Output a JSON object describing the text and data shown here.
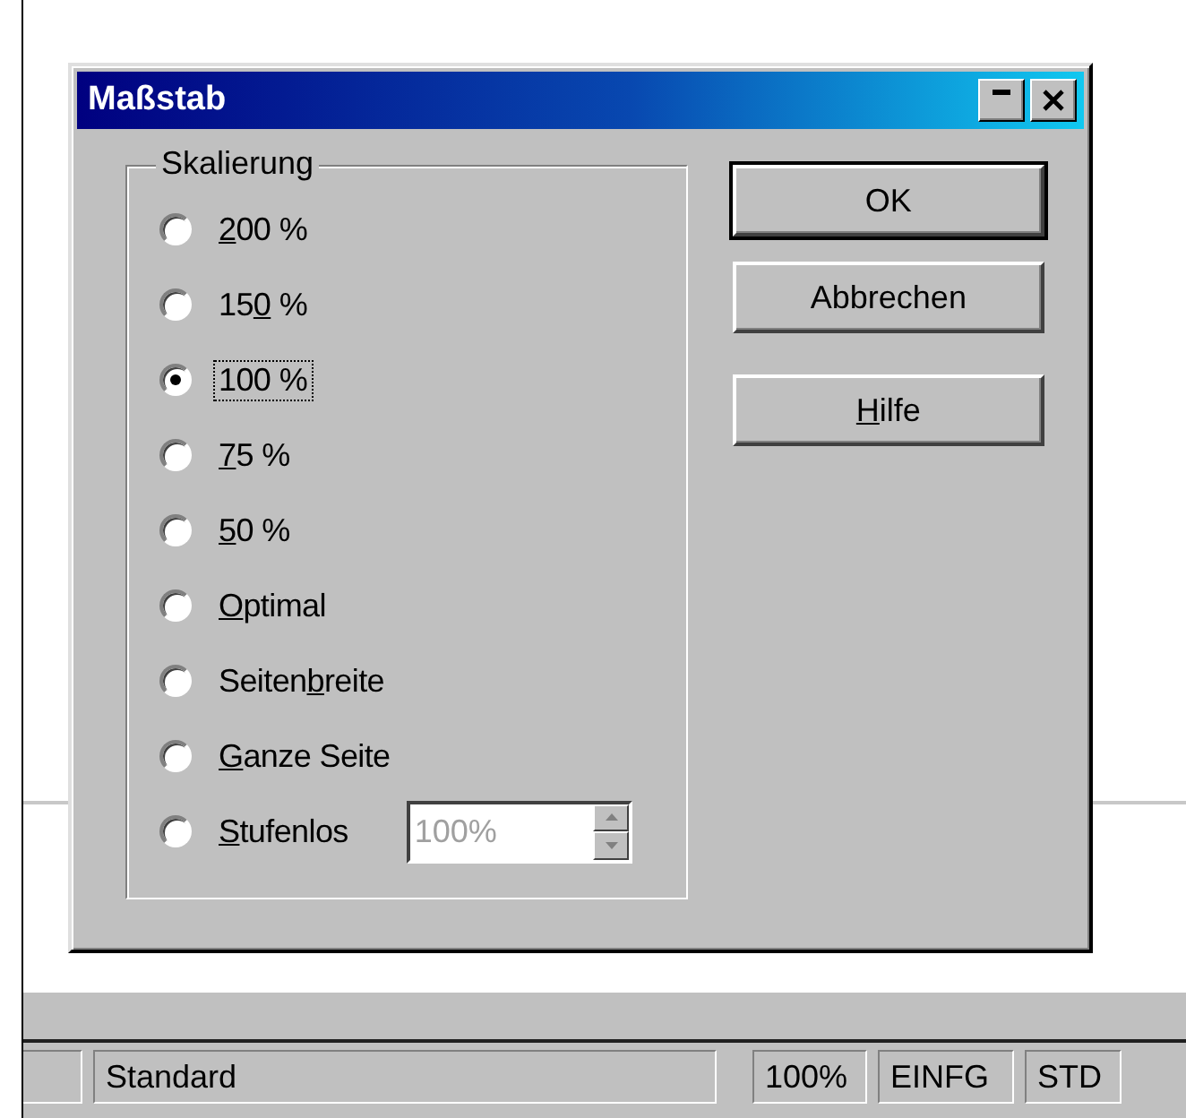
{
  "window": {
    "title": "Maßstab",
    "title_buttons": [
      {
        "kind": "minimize"
      },
      {
        "kind": "close"
      }
    ]
  },
  "group": {
    "label": "Skalierung",
    "options": [
      {
        "label": [
          {
            "text": "2",
            "underlined": true
          },
          {
            "text": "00 %",
            "underlined": false
          }
        ],
        "selected": false,
        "focused": false
      },
      {
        "label": [
          {
            "text": "15",
            "underlined": false
          },
          {
            "text": "0",
            "underlined": true
          },
          {
            "text": " %",
            "underlined": false
          }
        ],
        "selected": false,
        "focused": false
      },
      {
        "label": [
          {
            "text": "100 %",
            "underlined": false
          }
        ],
        "selected": true,
        "focused": true
      },
      {
        "label": [
          {
            "text": "7",
            "underlined": true
          },
          {
            "text": "5 %",
            "underlined": false
          }
        ],
        "selected": false,
        "focused": false
      },
      {
        "label": [
          {
            "text": "5",
            "underlined": true
          },
          {
            "text": "0 %",
            "underlined": false
          }
        ],
        "selected": false,
        "focused": false
      },
      {
        "label": [
          {
            "text": "O",
            "underlined": true
          },
          {
            "text": "ptimal",
            "underlined": false
          }
        ],
        "selected": false,
        "focused": false
      },
      {
        "label": [
          {
            "text": "Seiten",
            "underlined": false
          },
          {
            "text": "b",
            "underlined": true
          },
          {
            "text": "reite",
            "underlined": false
          }
        ],
        "selected": false,
        "focused": false
      },
      {
        "label": [
          {
            "text": "G",
            "underlined": true
          },
          {
            "text": "anze Seite",
            "underlined": false
          }
        ],
        "selected": false,
        "focused": false
      },
      {
        "label": [
          {
            "text": "S",
            "underlined": true
          },
          {
            "text": "tufenlos",
            "underlined": false
          }
        ],
        "selected": false,
        "focused": false
      }
    ],
    "spin_field": {
      "value": "100%",
      "disabled": true
    }
  },
  "buttons": [
    {
      "label": [
        {
          "text": "OK",
          "underlined": false
        }
      ],
      "default": true
    },
    {
      "label": [
        {
          "text": "Abbrechen",
          "underlined": false
        }
      ],
      "default": false
    },
    {
      "label": [
        {
          "text": "H",
          "underlined": true
        },
        {
          "text": "ilfe",
          "underlined": false
        }
      ],
      "default": false
    }
  ],
  "status_bar": {
    "cells": [
      "Standard",
      "100%",
      "EINFG",
      "STD"
    ]
  }
}
